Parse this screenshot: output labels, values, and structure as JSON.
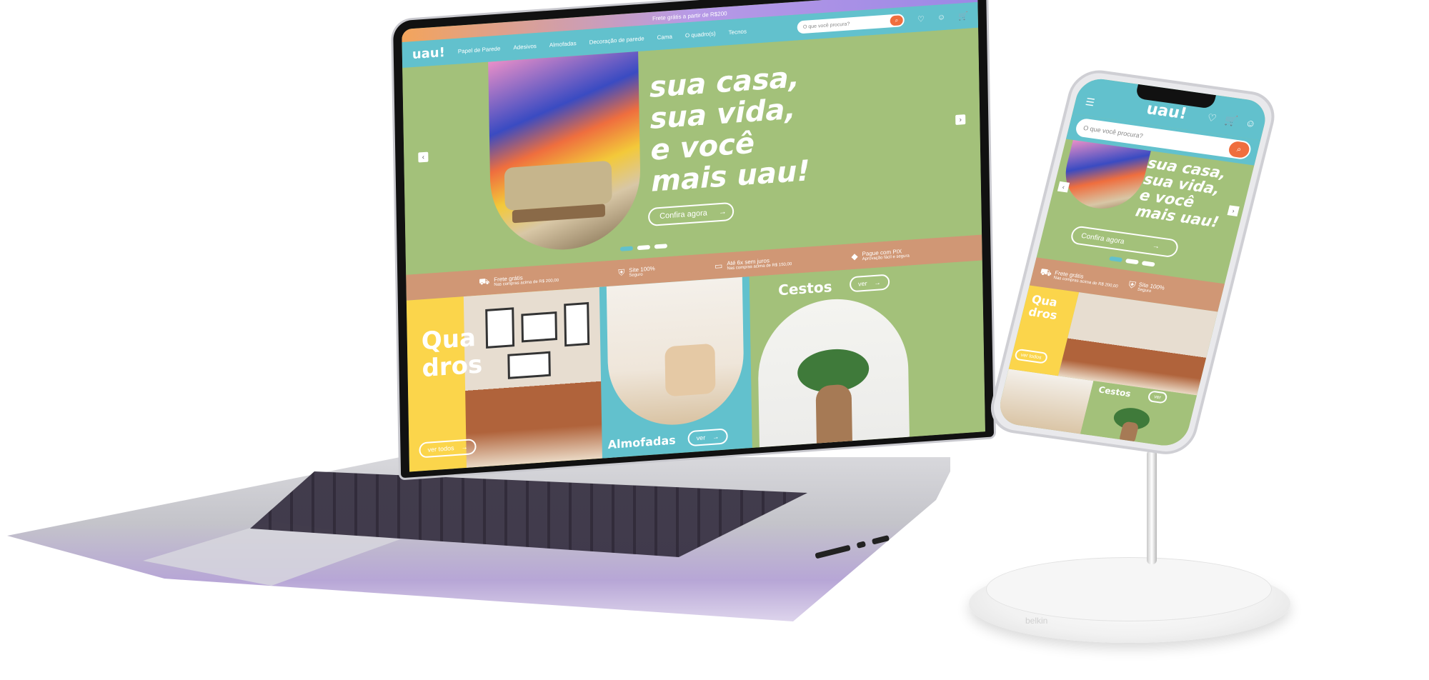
{
  "desktop": {
    "promo_text": "Frete grátis a partir de R$200",
    "logo": "uau!",
    "nav_items": [
      "Papel de Parede",
      "Adesivos",
      "Almofadas",
      "Decoração de parede",
      "Cama",
      "O quadro(s)",
      "Tecnos"
    ],
    "search_placeholder": "O que você procura?",
    "hero": {
      "title": "sua casa,\nsua vida,\ne você\nmais uau!",
      "cta": "Confira agora"
    },
    "benefits": [
      {
        "icon": "truck-icon",
        "title": "Frete grátis",
        "subtitle": "Nas compras acima de R$ 200,00"
      },
      {
        "icon": "shield-icon",
        "title": "Site 100%",
        "subtitle": "Seguro"
      },
      {
        "icon": "card-icon",
        "title": "Até 6x sem juros",
        "subtitle": "Nas compras acima de R$ 150,00"
      },
      {
        "icon": "pix-icon",
        "title": "Pague com PIX",
        "subtitle": "Aprovação fácil e segura"
      }
    ],
    "categories": {
      "quadros": {
        "title": "Qua\ndros",
        "button": "ver todos"
      },
      "almofadas": {
        "title": "Almofadas",
        "button": "ver"
      },
      "cestos": {
        "title": "Cestos",
        "button": "ver"
      }
    }
  },
  "mobile": {
    "logo": "uau!",
    "search_placeholder": "O que você procura?",
    "hero": {
      "title": "sua casa,\nsua vida,\ne você\nmais uau!",
      "cta": "Confira agora"
    },
    "benefits": [
      {
        "icon": "truck-icon",
        "title": "Frete grátis",
        "subtitle": "Nas compras acima de R$ 200,00"
      },
      {
        "icon": "shield-icon",
        "title": "Site 100%",
        "subtitle": "Seguro"
      }
    ],
    "categories": {
      "quadros": {
        "title": "Qua\ndros",
        "button": "ver todos"
      },
      "cestos": {
        "title": "Cestos",
        "button": "ver"
      }
    }
  },
  "stand_brand": "belkin",
  "colors": {
    "teal": "#62c1cd",
    "green": "#a3c17a",
    "yellow": "#fbd54b",
    "orange": "#ef6e3e",
    "tan": "#d09775"
  }
}
